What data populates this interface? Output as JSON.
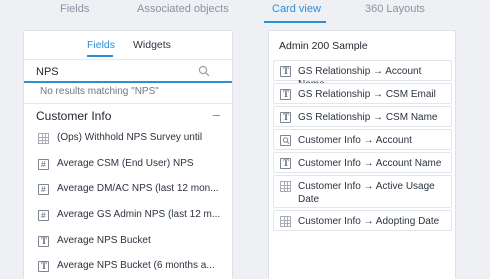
{
  "top_tabs": [
    {
      "label": "Fields"
    },
    {
      "label": "Associated objects"
    },
    {
      "label": "Card view",
      "active": true
    },
    {
      "label": "360 Layouts"
    }
  ],
  "left_panel": {
    "sub_tabs": [
      {
        "label": "Fields",
        "active": true
      },
      {
        "label": "Widgets"
      }
    ],
    "search": {
      "value": "NPS",
      "placeholder": ""
    },
    "no_results": "No results matching \"NPS\"",
    "section": {
      "title": "Customer Info",
      "collapse_symbol": "–",
      "items": [
        {
          "label": "(Ops) Withhold NPS Survey until",
          "icon": "grid-icon"
        },
        {
          "label": "Average CSM (End User) NPS",
          "icon": "number-icon"
        },
        {
          "label": "Average DM/AC NPS (last 12 mon...",
          "icon": "number-icon"
        },
        {
          "label": "Average GS Admin NPS (last 12 m...",
          "icon": "number-icon"
        },
        {
          "label": "Average NPS Bucket",
          "icon": "text-icon"
        },
        {
          "label": "Average NPS Bucket (6 months a...",
          "icon": "text-icon"
        }
      ]
    }
  },
  "right_panel": {
    "title": "Admin 200 Sample",
    "items": [
      {
        "label": "GS Relationship → Account Name",
        "icon": "text-icon"
      },
      {
        "label": "GS Relationship → CSM Email",
        "icon": "text-icon"
      },
      {
        "label": "GS Relationship → CSM Name",
        "icon": "text-icon"
      },
      {
        "label": "Customer Info → Account",
        "icon": "lookup-icon"
      },
      {
        "label": "Customer Info → Account Name",
        "icon": "text-icon"
      },
      {
        "label": "Customer Info → Active Usage Date",
        "icon": "grid-icon"
      },
      {
        "label": "Customer Info → Adopting Date",
        "icon": "grid-icon"
      }
    ]
  },
  "colors": {
    "accent": "#2b8fd6",
    "background": "#eef0f3"
  }
}
